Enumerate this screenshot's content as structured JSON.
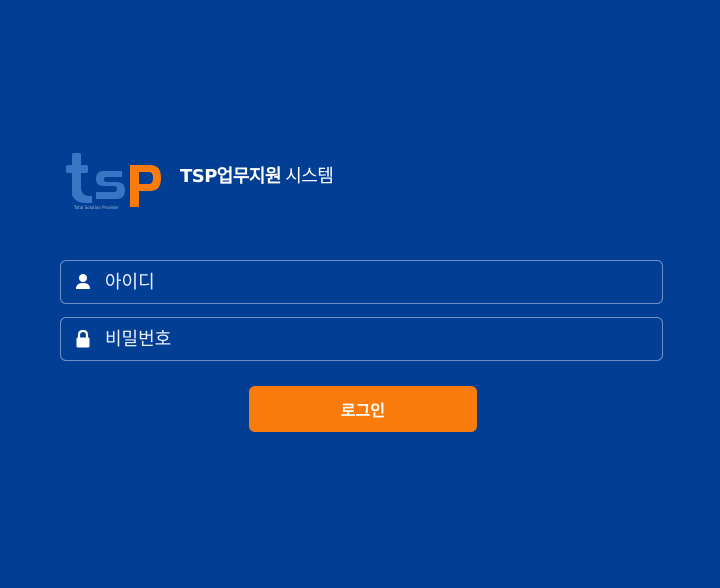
{
  "brand": {
    "logo_text": "tsp",
    "logo_subtext": "Total Solution Provider",
    "title_strong": "TSP업무지원",
    "title_light": "시스템"
  },
  "form": {
    "id_placeholder": "아이디",
    "password_placeholder": "비밀번호",
    "login_label": "로그인"
  },
  "colors": {
    "background": "#023f94",
    "button": "#f97b0c",
    "field_border": "#6f8fc6",
    "logo_blue": "#3a74c4",
    "logo_orange": "#f97b0c"
  },
  "icons": {
    "id_icon": "user-icon",
    "password_icon": "lock-icon"
  }
}
